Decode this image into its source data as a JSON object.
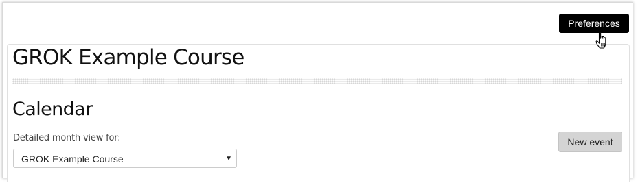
{
  "header": {
    "preferences_label": "Preferences"
  },
  "course": {
    "title": "GROK Example Course"
  },
  "calendar": {
    "title": "Calendar",
    "month_view_label": "Detailed month view for:",
    "selected_course": "GROK Example Course",
    "new_event_label": "New event"
  },
  "icons": {
    "cursor": "hand-pointer-icon",
    "dropdown": "dropdown-arrow-icon"
  },
  "colors": {
    "preferences_bg": "#000000",
    "new_event_bg": "#d4d4d4",
    "text": "#111111"
  }
}
